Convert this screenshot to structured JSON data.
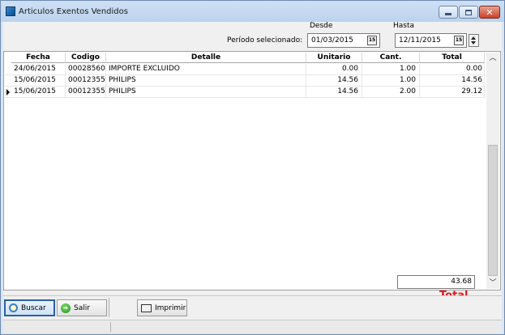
{
  "window": {
    "title": "Articulos Exentos Vendidos"
  },
  "filters": {
    "desde_label": "Desde",
    "hasta_label": "Hasta",
    "periodo_label": "Período selecionado:",
    "desde_value": "01/03/2015",
    "hasta_value": "12/11/2015",
    "calendar_glyph": "15"
  },
  "grid": {
    "columns": [
      "Fecha",
      "Codigo",
      "Detalle",
      "Unitario",
      "Cant.",
      "Total"
    ],
    "rows": [
      {
        "fecha": "24/06/2015",
        "codigo": "00028560",
        "detalle": "IMPORTE EXCLUIDO",
        "unitario": "0.00",
        "cant": "1.00",
        "total": "0.00",
        "current": false
      },
      {
        "fecha": "15/06/2015",
        "codigo": "00012355",
        "detalle": "PHILIPS",
        "unitario": "14.56",
        "cant": "1.00",
        "total": "14.56",
        "current": false
      },
      {
        "fecha": "15/06/2015",
        "codigo": "00012355",
        "detalle": "PHILIPS",
        "unitario": "14.56",
        "cant": "2.00",
        "total": "29.12",
        "current": true
      }
    ]
  },
  "summary": {
    "total_value": "43.68",
    "total_label": "Total"
  },
  "toolbar": {
    "buscar_label": "Buscar",
    "salir_label": "Salir",
    "imprimir_label": "Imprimir"
  },
  "colors": {
    "total_label": "#e0181b",
    "title_bar": "#bcd3ee"
  }
}
